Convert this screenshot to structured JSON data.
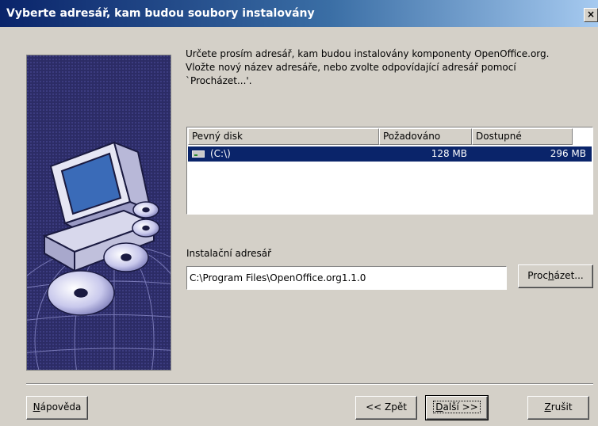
{
  "window": {
    "title": "Vyberte adresář, kam budou soubory instalovány",
    "close_glyph": "×"
  },
  "description": "Určete prosím adresář, kam budou instalovány komponenty OpenOffice.org. Vložte nový název adresáře, nebo zvolte odpovídající adresář pomocí `Procházet...'.",
  "disk_list": {
    "columns": [
      "Pevný disk",
      "Požadováno",
      "Dostupné"
    ],
    "rows": [
      {
        "icon": "hard-drive-icon",
        "disk": "(C:\\)",
        "required": "128 MB",
        "available": "296 MB",
        "selected": true
      }
    ]
  },
  "install_dir": {
    "label": "Instalační adresář",
    "value": "C:\\Program Files\\OpenOffice.org1.1.0"
  },
  "buttons": {
    "browse_pre": "Proc",
    "browse_u": "h",
    "browse_post": "ázet...",
    "help_u": "N",
    "help_post": "ápověda",
    "back": "<< Zpět",
    "next_u": "D",
    "next_post": "alší >>",
    "cancel_u": "Z",
    "cancel_post": "rušit"
  },
  "colors": {
    "title_start": "#0a246a",
    "title_end": "#a6caf0",
    "selection": "#0a246a",
    "dialog": "#d4d0c8",
    "art_background": "#24245a"
  }
}
